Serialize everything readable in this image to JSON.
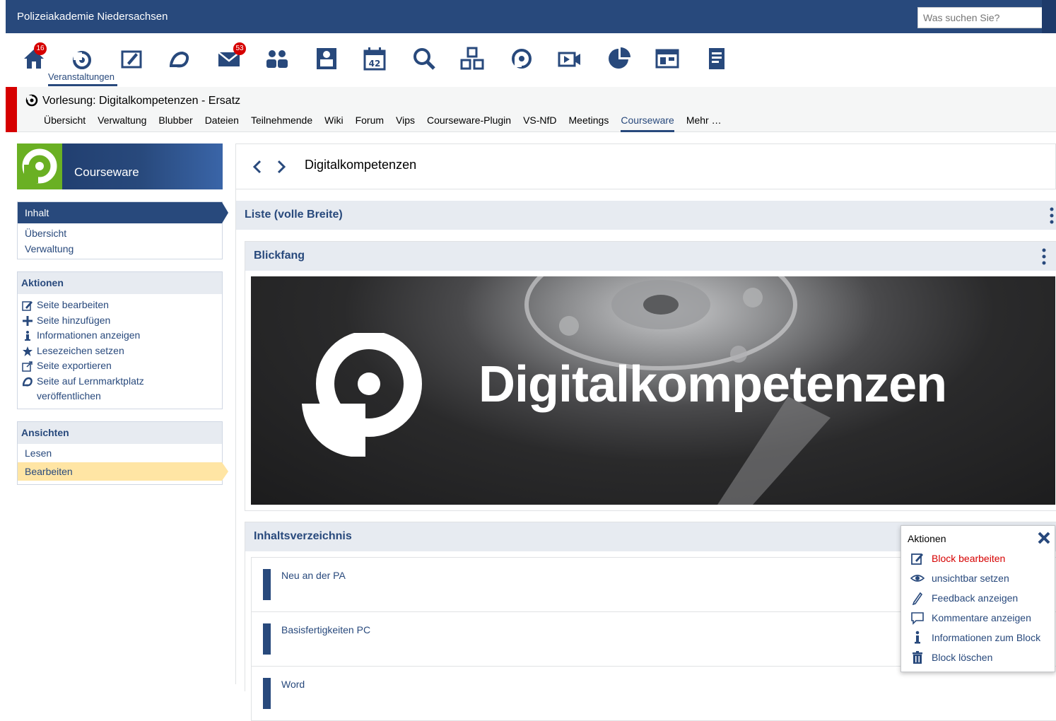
{
  "header": {
    "brand": "Polizeiakademie Niedersachsen",
    "search_placeholder": "Was suchen Sie?"
  },
  "iconbar": {
    "active_label": "Veranstaltungen",
    "badges": {
      "home": "16",
      "messages": "53"
    },
    "icons": [
      "home-icon",
      "courses-icon",
      "workplace-icon",
      "marketplace-icon",
      "messages-icon",
      "community-icon",
      "profile-icon",
      "planner-icon",
      "search-icon",
      "tools-icon",
      "courseware-icon",
      "video-icon",
      "stats-icon",
      "layout-icon",
      "documents-icon"
    ]
  },
  "course": {
    "title": "Vorlesung: Digitalkompetenzen - Ersatz",
    "tabs": [
      "Übersicht",
      "Verwaltung",
      "Blubber",
      "Dateien",
      "Teilnehmende",
      "Wiki",
      "Forum",
      "Vips",
      "Courseware-Plugin",
      "VS-NfD",
      "Meetings",
      "Courseware",
      "Mehr …"
    ],
    "active_tab": "Courseware"
  },
  "sidebar": {
    "title": "Courseware",
    "nav": [
      "Inhalt",
      "Übersicht",
      "Verwaltung"
    ],
    "actions_title": "Aktionen",
    "actions": [
      "Seite bearbeiten",
      "Seite hinzufügen",
      "Informationen anzeigen",
      "Lesezeichen setzen",
      "Seite exportieren",
      "Seite auf Lernmarktplatz veröffentlichen"
    ],
    "views_title": "Ansichten",
    "views": [
      "Lesen",
      "Bearbeiten"
    ]
  },
  "main": {
    "page_title": "Digitalkompetenzen",
    "section_title": "Liste (volle Breite)",
    "block1_title": "Blickfang",
    "hero_text": "Digitalkompetenzen",
    "block2_title": "Inhaltsverzeichnis",
    "toc": [
      "Neu an der PA",
      "Basisfertigkeiten PC",
      "Word"
    ]
  },
  "popup": {
    "title": "Aktionen",
    "items": [
      "Block bearbeiten",
      "unsichtbar setzen",
      "Feedback anzeigen",
      "Kommentare anzeigen",
      "Informationen zum Block",
      "Block löschen"
    ]
  },
  "colors": {
    "primary": "#28497c",
    "accent_red": "#d60000",
    "highlight": "#ffe5a4",
    "green": "#6ab023"
  }
}
